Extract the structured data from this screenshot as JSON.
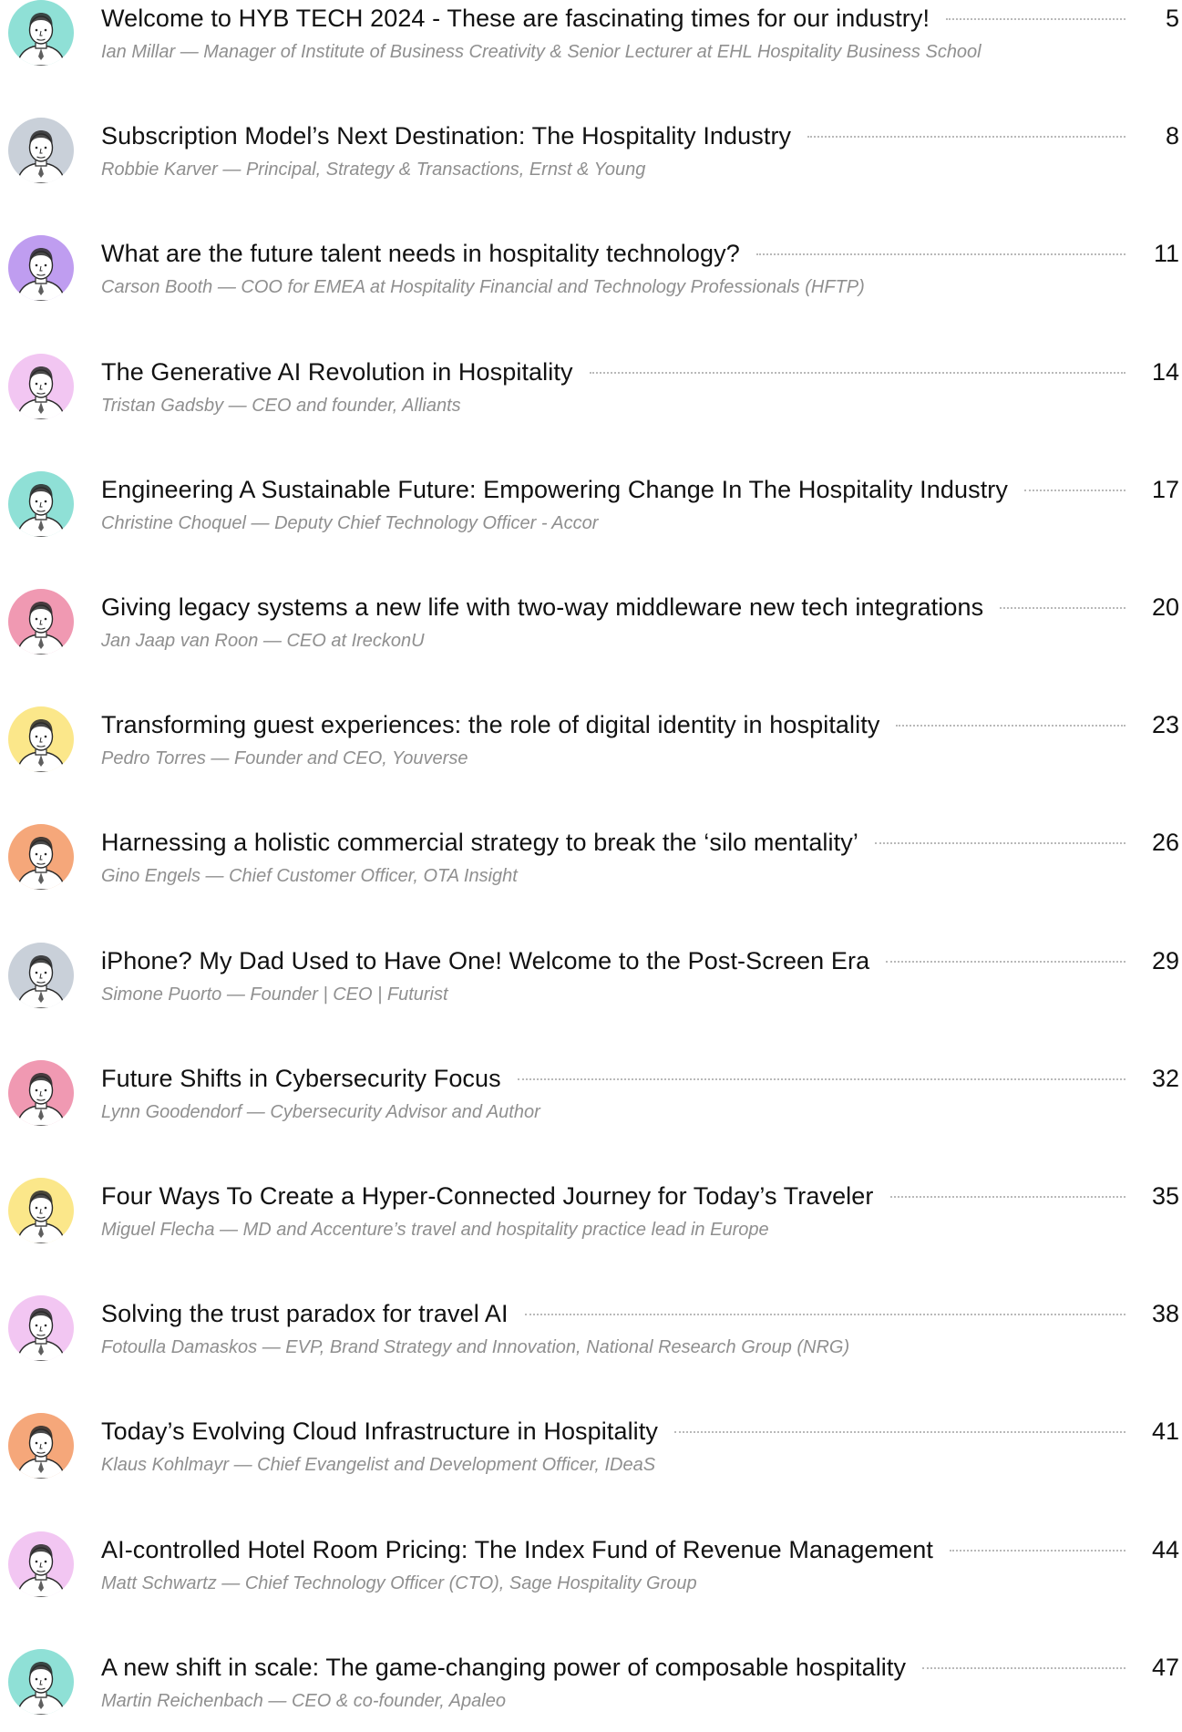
{
  "entries": [
    {
      "title": "Welcome to HYB TECH 2024 - These are fascinating times for our industry!",
      "byline": "Ian Millar — Manager of Institute of Business Creativity & Senior Lecturer at EHL Hospitality Business School",
      "page": "5",
      "avatar_color": "#8fe0d6"
    },
    {
      "title": "Subscription Model’s Next Destination: The Hospitality Industry",
      "byline": "Robbie Karver — Principal, Strategy & Transactions, Ernst & Young",
      "page": "8",
      "avatar_color": "#c9d0d9"
    },
    {
      "title": "What are the future talent needs in hospitality technology?",
      "byline": "Carson Booth — COO for EMEA at Hospitality Financial and Technology Professionals (HFTP)",
      "page": "11",
      "avatar_color": "#bf9df0"
    },
    {
      "title": "The Generative AI Revolution in Hospitality",
      "byline": "Tristan Gadsby — CEO and founder, Alliants",
      "page": "14",
      "avatar_color": "#f2c6f2"
    },
    {
      "title": "Engineering A Sustainable Future: Empowering Change In The Hospitality Industry",
      "byline": "Christine Choquel — Deputy Chief Technology Officer - Accor",
      "page": "17",
      "avatar_color": "#8fe0d6"
    },
    {
      "title": "Giving legacy systems a new life with two-way middleware new tech integrations",
      "byline": "Jan Jaap van Roon — CEO at IreckonU",
      "page": "20",
      "avatar_color": "#f099b2"
    },
    {
      "title": "Transforming guest experiences: the role of digital identity in hospitality",
      "byline": "Pedro Torres — Founder and CEO, Youverse",
      "page": "23",
      "avatar_color": "#fbe78a"
    },
    {
      "title": "Harnessing a holistic commercial strategy to break the ‘silo mentality’",
      "byline": "Gino Engels — Chief Customer Officer, OTA Insight",
      "page": "26",
      "avatar_color": "#f5a77a"
    },
    {
      "title": "iPhone? My Dad Used to Have One! Welcome to the Post-Screen Era",
      "byline": "Simone Puorto — Founder | CEO | Futurist",
      "page": "29",
      "avatar_color": "#c9d0d9"
    },
    {
      "title": "Future Shifts in Cybersecurity Focus",
      "byline": "Lynn Goodendorf — Cybersecurity Advisor and Author",
      "page": "32",
      "avatar_color": "#f099b2"
    },
    {
      "title": "Four Ways To Create a Hyper-Connected Journey for Today’s Traveler",
      "byline": "Miguel Flecha — MD and Accenture’s travel and hospitality practice lead in Europe",
      "page": "35",
      "avatar_color": "#fbe78a"
    },
    {
      "title": "Solving the trust paradox for travel AI",
      "byline": "Fotoulla Damaskos — EVP, Brand Strategy and Innovation, National Research Group (NRG)",
      "page": "38",
      "avatar_color": "#f2c6f2"
    },
    {
      "title": "Today’s Evolving Cloud Infrastructure in Hospitality",
      "byline": "Klaus Kohlmayr — Chief Evangelist and Development Officer, IDeaS",
      "page": "41",
      "avatar_color": "#f5a77a"
    },
    {
      "title": "AI-controlled Hotel Room Pricing: The Index Fund of Revenue Management",
      "byline": "Matt Schwartz — Chief Technology Officer (CTO), Sage Hospitality Group",
      "page": "44",
      "avatar_color": "#f2c6f2"
    },
    {
      "title": "A new shift in scale: The game-changing power of composable hospitality",
      "byline": "Martin Reichenbach — CEO & co-founder, Apaleo",
      "page": "47",
      "avatar_color": "#8fe0d6"
    }
  ]
}
